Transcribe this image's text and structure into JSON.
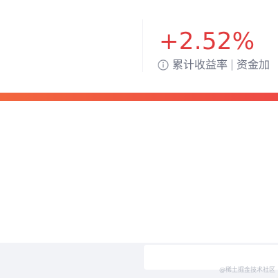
{
  "return_card": {
    "value": "+2.52%",
    "label": "累计收益率",
    "secondary_label": "资金加",
    "value_color": "#e0393b",
    "info_icon": "info-circle-icon"
  },
  "progress": {
    "fill_fraction": 1.0,
    "start_color": "#f2663e",
    "end_color": "#ee4a44"
  },
  "watermark": "@稀土掘金技术社区"
}
